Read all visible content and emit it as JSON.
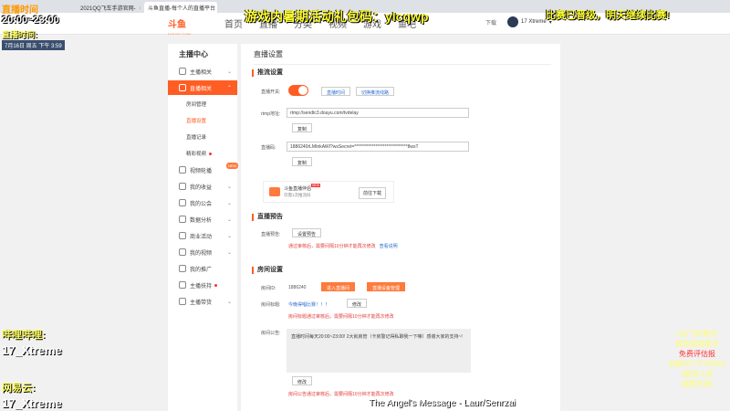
{
  "browser": {
    "tabs": [
      {
        "label": "2021QQ飞车手游官网-",
        "active": false
      },
      {
        "label": "斗鱼直播-每个人的直播平台",
        "active": true
      }
    ]
  },
  "header": {
    "logo_text": "斗鱼",
    "logo_sub": "DOUYU.COM",
    "nav": [
      "首页",
      "直播",
      "分类",
      "视频",
      "游戏",
      "鱼吧"
    ],
    "download": "下载",
    "username": "17 Xtreme"
  },
  "sidebar": {
    "title": "主播中心",
    "items": [
      {
        "label": "主播相关",
        "icon": "mic-icon"
      },
      {
        "label": "直播相关",
        "icon": "broadcast-icon",
        "active": true
      },
      {
        "label": "视频轮播",
        "icon": "video-icon",
        "badge": "NEW"
      },
      {
        "label": "我的收益",
        "icon": "wallet-icon"
      },
      {
        "label": "我的公会",
        "icon": "guild-icon"
      },
      {
        "label": "数据分析",
        "icon": "chart-icon"
      },
      {
        "label": "商业活动",
        "icon": "business-icon"
      },
      {
        "label": "我的视频",
        "icon": "film-icon"
      },
      {
        "label": "我的推广",
        "icon": "promote-icon"
      },
      {
        "label": "主播扶持",
        "icon": "support-icon"
      },
      {
        "label": "主播带货",
        "icon": "shop-icon"
      }
    ],
    "subitems": [
      "房间管理",
      "直播设置",
      "直播记录",
      "精彩视频"
    ]
  },
  "main": {
    "title": "直播设置",
    "push": {
      "section": "推流设置",
      "switch_label": "直播开关:",
      "switch_on": true,
      "btn_switch": "直播时间",
      "btn_switch2": "切换推流线路",
      "rtmp_label": "rtmp地址:",
      "rtmp_value": "rtmp://sendtc3.douyu.com/tvdelay",
      "copy": "复制",
      "code_label": "直播码:",
      "code_value": "1886240rLMtnkAWI?wsSecret=******************************8wsT",
      "copy2": "复制",
      "tool_title": "斗鱼直播伴侣",
      "tool_new": "NEW",
      "tool_desc": "仅需1次推流码",
      "tool_btn": "前往下载"
    },
    "preview": {
      "section": "直播预告",
      "label": "直播预告:",
      "btn": "设置预告",
      "note": "通过审核后，需要间隔10分钟才能再次修改",
      "note_link": "查看说明"
    },
    "room": {
      "section": "房间设置",
      "id_label": "房间ID:",
      "id_value": "1886240",
      "btn_enter": "进入直播间",
      "btn_manage": "直播设备管理",
      "title_label": "房间标题:",
      "title_value": "今晚得唱比赛！！！",
      "btn_edit": "修改",
      "title_note": "房间标题通过审核后，需要间隔10分钟才能再次修改",
      "notice_label": "房间公告:",
      "notice_value": "直播时间每天20:00~23:00!  2大就房管（卡房警记得私聊我一下嘛）感谢大家的支持~!",
      "btn_edit2": "修改",
      "notice_note": "房间公告通过审核后，需要间隔10分钟才能再次修改"
    }
  },
  "overlay": {
    "bili_head": "直播时间",
    "time_range": "20:00~23:00",
    "stream_time_label": "直播时间:",
    "date": "7月16日 周五 下午 3:59",
    "gift": "游戏内暑期活动礼包码：ylcqwp",
    "race": "比赛已晋级，明天继续比赛!",
    "bili_label": "哔哩哔哩:",
    "bili_value": "17_Xtreme",
    "netease_label": "网易云:",
    "netease_value": "17_Xtreme",
    "song": "The Angel's Message - Laur/Senrzai",
    "qq_lines": [
      "QQ飞车账号",
      "其他游戏账号",
      "免费评估报",
      "扣群557378924",
      "(脱坑入坑",
      "加群咨询)"
    ]
  }
}
